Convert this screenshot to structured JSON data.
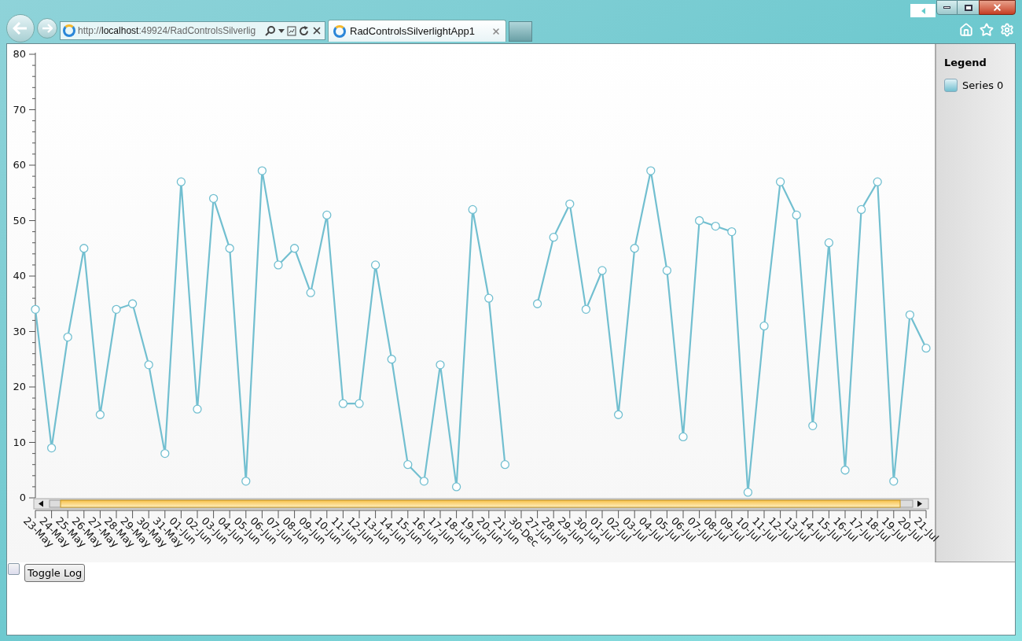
{
  "browser": {
    "address": "http://**localhost**:49924/RadControlsSilverlig",
    "tabs": [
      {
        "title": "RadControlsSilverlightApp1",
        "selected": true
      }
    ]
  },
  "chart": {
    "chart_data": {
      "type": "line",
      "categories": [
        "23-May",
        "24-May",
        "25-May",
        "26-May",
        "27-May",
        "28-May",
        "29-May",
        "30-May",
        "31-May",
        "01-Jun",
        "02-Jun",
        "03-Jun",
        "04-Jun",
        "05-Jun",
        "06-Jun",
        "07-Jun",
        "08-Jun",
        "09-Jun",
        "10-Jun",
        "11-Jun",
        "12-Jun",
        "13-Jun",
        "14-Jun",
        "15-Jun",
        "16-Jun",
        "17-Jun",
        "18-Jun",
        "19-Jun",
        "20-Jun",
        "21-Jun",
        "30-Dec",
        "27-Jun",
        "28-Jun",
        "29-Jun",
        "30-Jun",
        "01-Jul",
        "02-Jul",
        "03-Jul",
        "04-Jul",
        "05-Jul",
        "06-Jul",
        "07-Jul",
        "08-Jul",
        "09-Jul",
        "10-Jul",
        "11-Jul",
        "12-Jul",
        "13-Jul",
        "14-Jul",
        "15-Jul",
        "16-Jul",
        "17-Jul",
        "18-Jul",
        "19-Jul",
        "20-Jul",
        "21-Jul"
      ],
      "series": [
        {
          "name": "Series 0",
          "color": "#72bfd0",
          "marker": "circle",
          "values": [
            34,
            9,
            29,
            45,
            15,
            34,
            35,
            24,
            8,
            57,
            16,
            54,
            45,
            3,
            59,
            42,
            45,
            37,
            51,
            17,
            17,
            42,
            25,
            6,
            3,
            24,
            2,
            52,
            36,
            6,
            null,
            35,
            47,
            53,
            34,
            41,
            15,
            45,
            59,
            41,
            11,
            50,
            49,
            48,
            1,
            31,
            57,
            51,
            13,
            46,
            5,
            52,
            57,
            3,
            33,
            27
          ]
        }
      ],
      "ylim": [
        0,
        80
      ],
      "yticks": [
        0,
        10,
        20,
        30,
        40,
        50,
        60,
        70,
        80
      ]
    }
  },
  "legend": {
    "title": "Legend"
  },
  "controls": {
    "checkbox": {
      "checked": false
    },
    "button": "Toggle Log"
  }
}
